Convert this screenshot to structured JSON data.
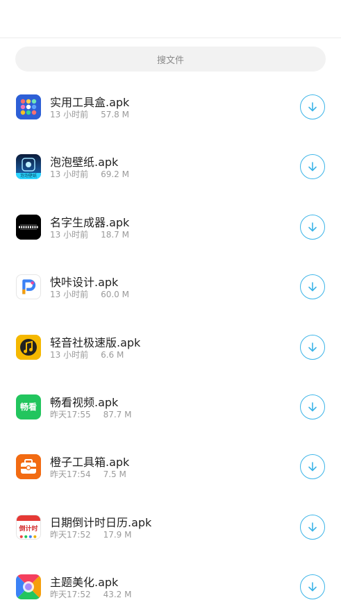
{
  "search": {
    "placeholder": "搜文件"
  },
  "colors": {
    "accent": "#3bb4e8"
  },
  "files": [
    {
      "name": "实用工具盒.apk",
      "time": "13 小时前",
      "size": "57.8 M",
      "icon": "toolbox-grid-icon"
    },
    {
      "name": "泡泡壁纸.apk",
      "time": "13 小时前",
      "size": "69.2 M",
      "icon": "bubble-wallpaper-icon",
      "icon_text": "泡泡壁纸"
    },
    {
      "name": "名字生成器.apk",
      "time": "13 小时前",
      "size": "18.7 M",
      "icon": "name-generator-icon"
    },
    {
      "name": "快咔设计.apk",
      "time": "13 小时前",
      "size": "60.0 M",
      "icon": "kuaika-p-logo-icon"
    },
    {
      "name": "轻音社极速版.apk",
      "time": "13 小时前",
      "size": "6.6 M",
      "icon": "music-note-icon"
    },
    {
      "name": "畅看视频.apk",
      "time": "昨天17:55",
      "size": "87.7 M",
      "icon": "changkan-video-icon",
      "icon_text": "畅看"
    },
    {
      "name": "橙子工具箱.apk",
      "time": "昨天17:54",
      "size": "7.5 M",
      "icon": "orange-toolbox-icon"
    },
    {
      "name": "日期倒计时日历.apk",
      "time": "昨天17:52",
      "size": "17.9 M",
      "icon": "countdown-calendar-icon",
      "icon_text": "倒计时"
    },
    {
      "name": "主题美化.apk",
      "time": "昨天17:52",
      "size": "43.2 M",
      "icon": "theme-beautify-icon"
    }
  ]
}
